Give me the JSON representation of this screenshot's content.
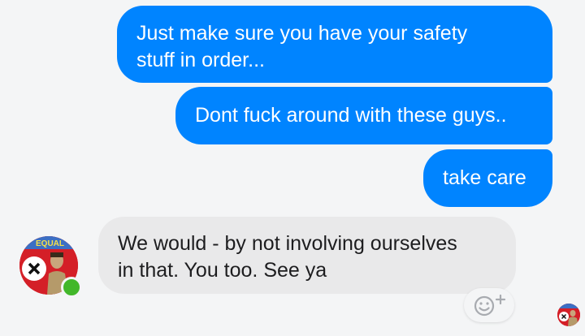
{
  "messages": [
    {
      "direction": "outgoing",
      "lines": [
        "Just make sure you have your safety",
        "stuff in order..."
      ]
    },
    {
      "direction": "outgoing",
      "lines": [
        "Dont fuck around with these guys.."
      ]
    },
    {
      "direction": "outgoing",
      "lines": [
        "take care"
      ]
    },
    {
      "direction": "incoming",
      "lines": [
        "We would - by not involving ourselves",
        "in that. You too. See ya"
      ]
    }
  ],
  "contact": {
    "avatar_icon": "contact-avatar",
    "avatar_text": "EQUAL",
    "online": true
  },
  "reaction_button": {
    "icon": "add-reaction-icon"
  },
  "seen_indicator": {
    "icon": "seen-avatar"
  },
  "colors": {
    "outgoing_bubble": "#0084ff",
    "incoming_bubble": "#e9e9ea",
    "background": "#f4f5f6",
    "online": "#42b72a"
  }
}
